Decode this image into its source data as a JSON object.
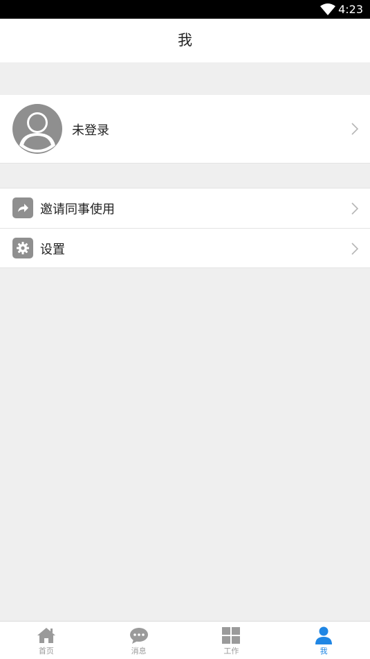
{
  "status_bar": {
    "time": "4:23",
    "wifi_icon": "wifi-icon"
  },
  "header": {
    "title": "我"
  },
  "profile": {
    "name": "未登录",
    "avatar_icon": "avatar-placeholder-icon"
  },
  "menu": {
    "items": [
      {
        "label": "邀请同事使用",
        "icon": "share-icon"
      },
      {
        "label": "设置",
        "icon": "gear-icon"
      }
    ]
  },
  "tabs": [
    {
      "label": "首页",
      "icon": "home-icon",
      "active": false
    },
    {
      "label": "消息",
      "icon": "chat-icon",
      "active": false
    },
    {
      "label": "工作",
      "icon": "grid-icon",
      "active": false
    },
    {
      "label": "我",
      "icon": "person-icon",
      "active": true
    }
  ],
  "colors": {
    "accent": "#1f86e4",
    "background": "#efefef",
    "icon_gray": "#8f8f8f",
    "tab_inactive": "#9a9a9a"
  }
}
